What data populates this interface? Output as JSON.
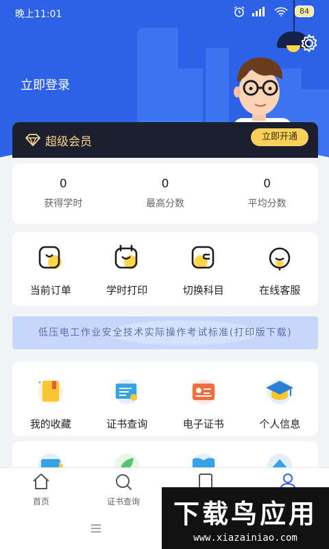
{
  "status_bar": {
    "time": "晚上11:01",
    "battery": "84"
  },
  "header": {
    "login_text": "立即登录",
    "vip_label": "超级会员",
    "vip_button": "立即开通",
    "brand_color": "#2d62e8",
    "vip_gold": "#f6d48c"
  },
  "stats": [
    {
      "value": "0",
      "label": "获得学时"
    },
    {
      "value": "0",
      "label": "最高分数"
    },
    {
      "value": "0",
      "label": "平均分数"
    }
  ],
  "menu_primary": [
    {
      "label": "当前订单",
      "icon": "order-icon"
    },
    {
      "label": "学时打印",
      "icon": "print-icon"
    },
    {
      "label": "切换科目",
      "icon": "switch-subject-icon"
    },
    {
      "label": "在线客服",
      "icon": "customer-service-icon"
    }
  ],
  "banner": {
    "text": "低压电工作业安全技术实际操作考试标准(打印版下载)"
  },
  "menu_secondary": [
    {
      "label": "我的收藏",
      "icon": "favorites-icon"
    },
    {
      "label": "证书查询",
      "icon": "certificate-query-icon"
    },
    {
      "label": "电子证书",
      "icon": "e-certificate-icon"
    },
    {
      "label": "个人信息",
      "icon": "personal-info-icon"
    }
  ],
  "tabbar": [
    {
      "label": "首页",
      "icon": "home-icon"
    },
    {
      "label": "证书查询",
      "icon": "search-icon"
    },
    {
      "label": "",
      "icon": "bookmark-icon"
    },
    {
      "label": "",
      "icon": "profile-icon"
    }
  ],
  "watermark": {
    "title": "下载鸟应用",
    "url": "www.xiazainiao.com"
  }
}
